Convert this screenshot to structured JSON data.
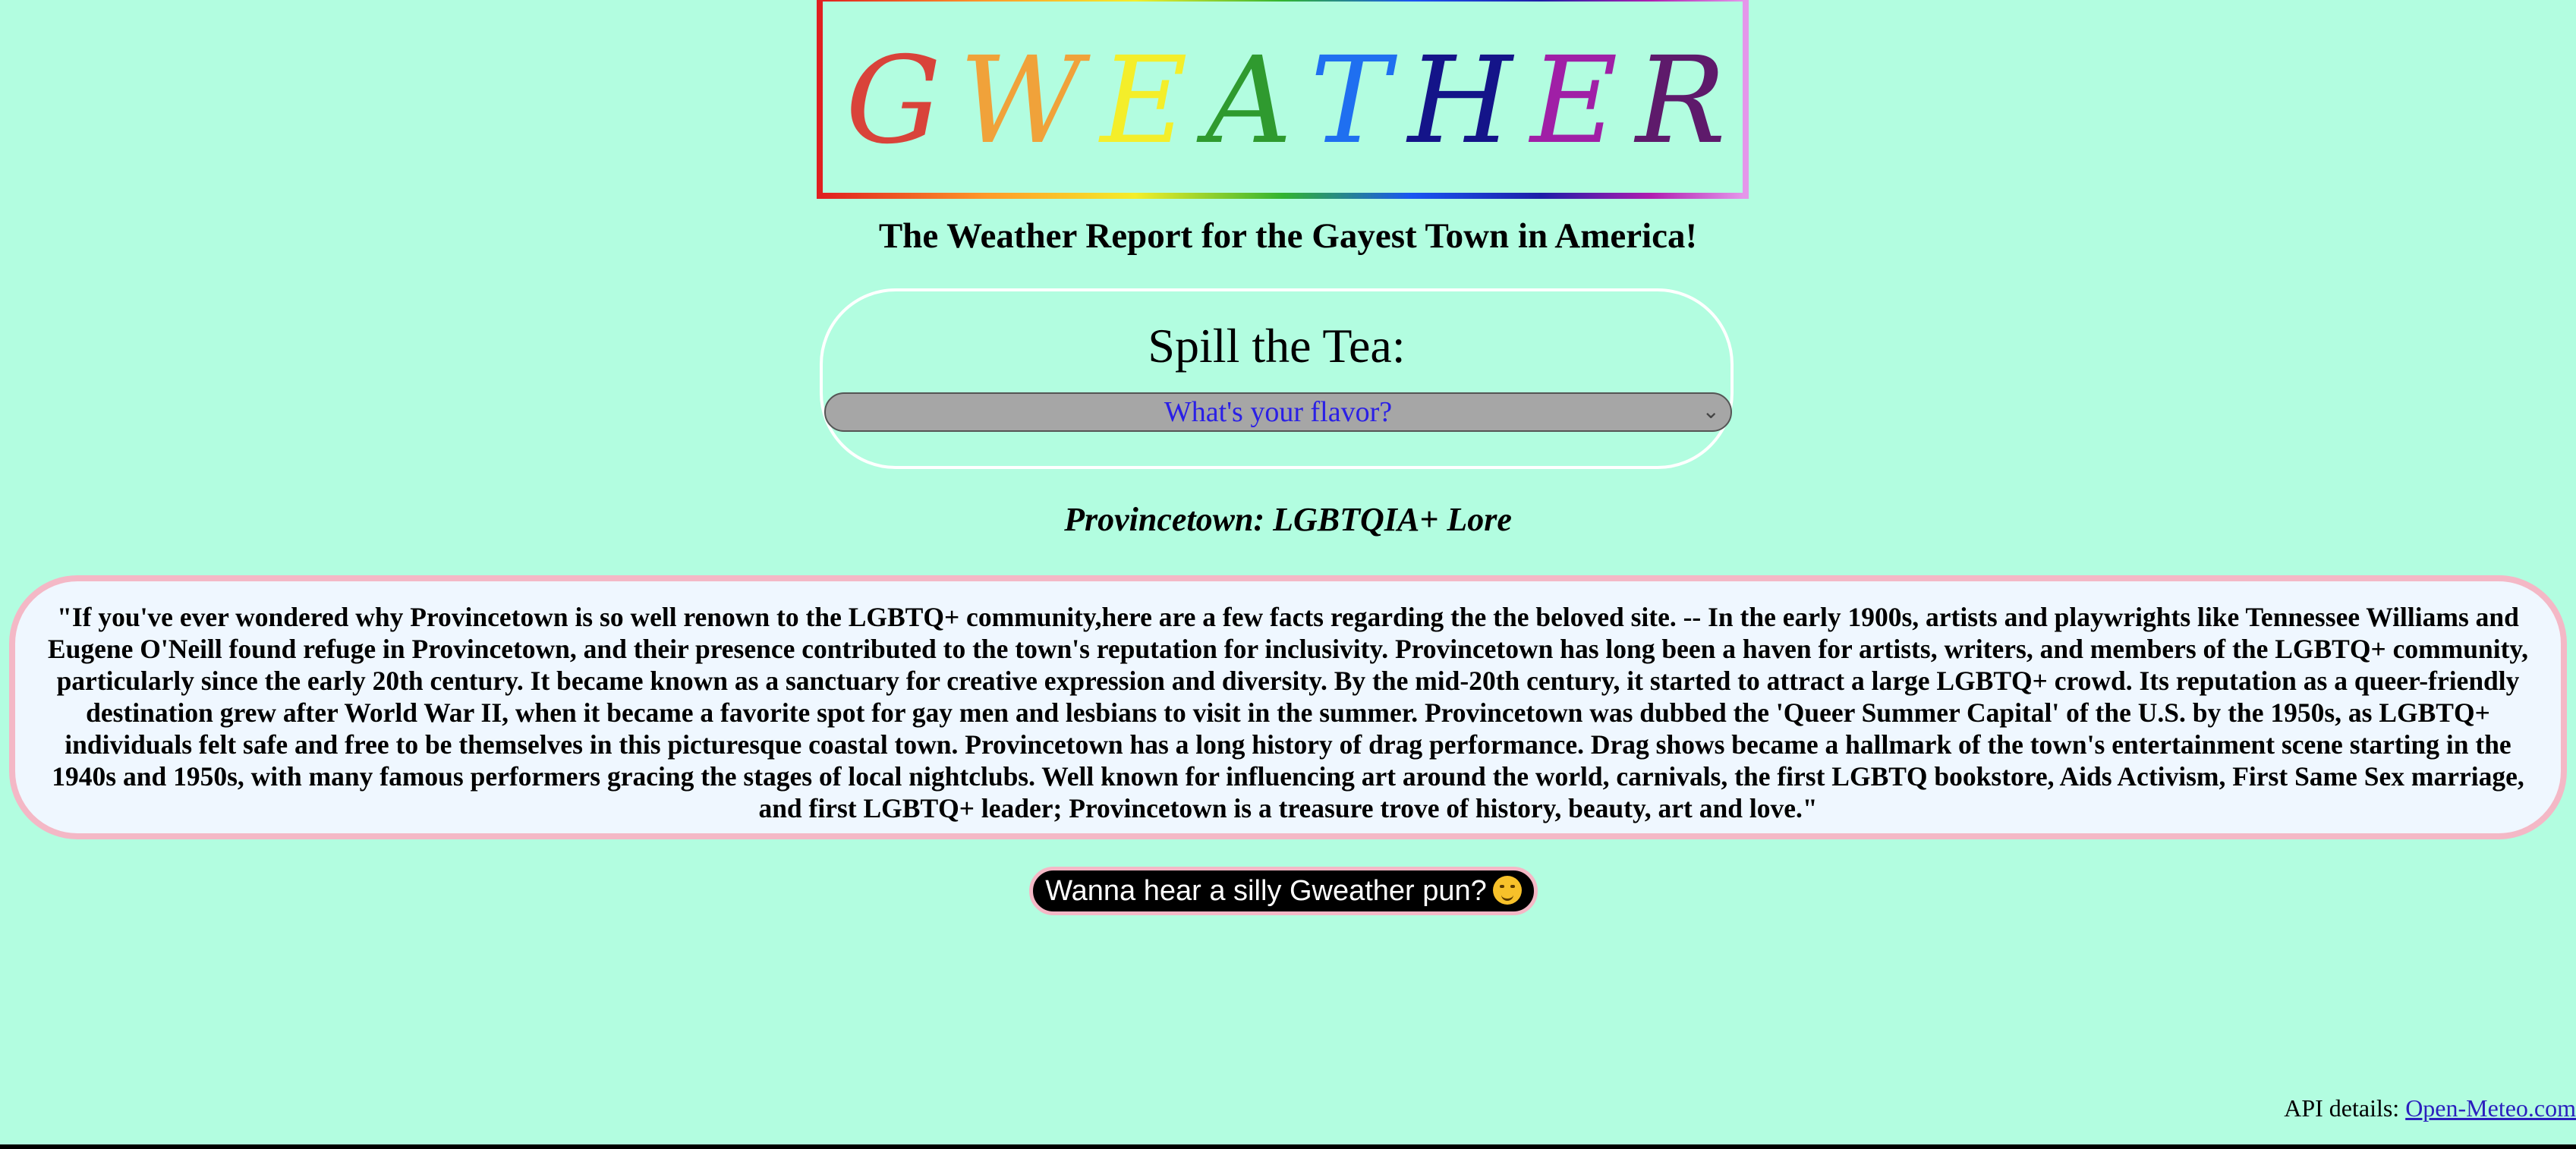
{
  "logo": {
    "letters": [
      {
        "char": "G",
        "color": "#d9433a"
      },
      {
        "char": "W",
        "color": "#f0a23a"
      },
      {
        "char": "E",
        "color": "#f4ee2a"
      },
      {
        "char": "A",
        "color": "#2f9a2f"
      },
      {
        "char": "T",
        "color": "#1f6ff0"
      },
      {
        "char": "H",
        "color": "#141489"
      },
      {
        "char": "E",
        "color": "#a01fa6"
      },
      {
        "char": "R",
        "color": "#5e1a6b"
      }
    ]
  },
  "tagline": "The Weather Report for the Gayest Town in America!",
  "tea": {
    "label": "Spill the Tea:",
    "select_value": "What's your flavor?"
  },
  "lore": {
    "title": "Provincetown: LGBTQIA+ Lore",
    "text": "\"If you've ever wondered why Provincetown is so well renown to the LGBTQ+ community,here are a few facts regarding the the beloved site. -- In the early 1900s, artists and playwrights like Tennessee Williams and Eugene O'Neill found refuge in Provincetown, and their presence contributed to the town's reputation for inclusivity. Provincetown has long been a haven for artists, writers, and members of the LGBTQ+ community, particularly since the early 20th century. It became known as a sanctuary for creative expression and diversity. By the mid-20th century, it started to attract a large LGBTQ+ crowd. Its reputation as a queer-friendly destination grew after World War II, when it became a favorite spot for gay men and lesbians to visit in the summer. Provincetown was dubbed the 'Queer Summer Capital' of the U.S. by the 1950s, as LGBTQ+ individuals felt safe and free to be themselves in this picturesque coastal town. Provincetown has a long history of drag performance. Drag shows became a hallmark of the town's entertainment scene starting in the 1940s and 1950s, with many famous performers gracing the stages of local nightclubs. Well known for influencing art around the world, carnivals, the first LGBTQ bookstore, Aids Activism, First Same Sex marriage, and first LGBTQ+ leader; Provincetown is a treasure trove of history, beauty, art and love.\""
  },
  "pun_button": {
    "label": "Wanna hear a silly Gweather pun?",
    "icon": "shushing-face-emoji"
  },
  "footer": {
    "api_label": "API details: ",
    "api_link": "Open-Meteo.com"
  },
  "colors": {
    "background": "#b2fde0",
    "lore_border": "#f4b8c6",
    "lore_background": "#eff7ff",
    "select_text": "#2a1fe6"
  }
}
